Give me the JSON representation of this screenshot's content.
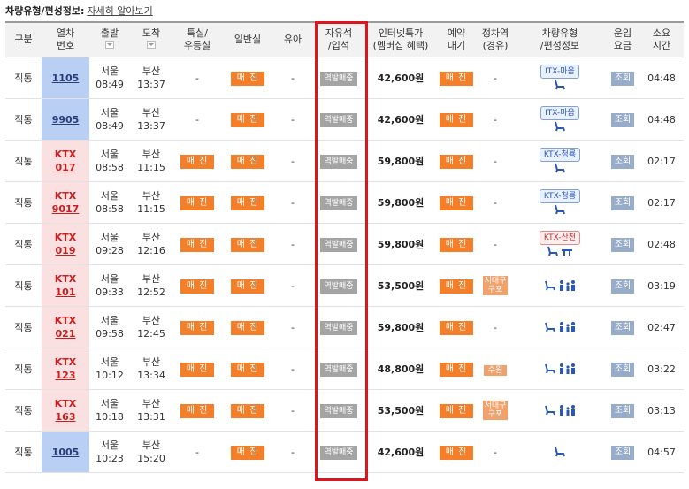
{
  "header": {
    "title": "차량유형/편성정보:",
    "link": "자세히 알아보기"
  },
  "columns": [
    {
      "line1": "구분",
      "line2": ""
    },
    {
      "line1": "열차",
      "line2": "번호"
    },
    {
      "line1": "출발",
      "line2": ""
    },
    {
      "line1": "도착",
      "line2": ""
    },
    {
      "line1": "특실/",
      "line2": "우등실"
    },
    {
      "line1": "일반실",
      "line2": ""
    },
    {
      "line1": "유아",
      "line2": ""
    },
    {
      "line1": "자유석",
      "line2": "/입석"
    },
    {
      "line1": "인터넷특가",
      "line2": "(멤버십 혜택)"
    },
    {
      "line1": "예약",
      "line2": "대기"
    },
    {
      "line1": "정차역",
      "line2": "(경유)"
    },
    {
      "line1": "차량유형",
      "line2": "/편성정보"
    },
    {
      "line1": "운임",
      "line2": "요금"
    },
    {
      "line1": "소요",
      "line2": "시간"
    }
  ],
  "labels": {
    "sold": "매 진",
    "free": "역발매중",
    "lookup": "조회",
    "dash": "-",
    "ktx": "KTX"
  },
  "rows": [
    {
      "type": "직통",
      "prefix": "",
      "num": "1105",
      "cls": "blue",
      "dep": "서울",
      "dep_t": "08:49",
      "arr": "부산",
      "arr_t": "13:37",
      "special": "-",
      "general": "매 진",
      "infant": "-",
      "free": "역발매중",
      "price": "42,600원",
      "wait": "매 진",
      "stop": "-",
      "vehicle": "ITX-마음",
      "icons": [
        "seat"
      ],
      "fare": "조회",
      "dur": "04:48"
    },
    {
      "type": "직통",
      "prefix": "",
      "num": "9905",
      "cls": "blue",
      "dep": "서울",
      "dep_t": "08:49",
      "arr": "부산",
      "arr_t": "13:37",
      "special": "-",
      "general": "매 진",
      "infant": "-",
      "free": "역발매중",
      "price": "42,600원",
      "wait": "매 진",
      "stop": "-",
      "vehicle": "ITX-마음",
      "icons": [
        "seat"
      ],
      "fare": "조회",
      "dur": "04:48"
    },
    {
      "type": "직통",
      "prefix": "KTX",
      "num": "017",
      "cls": "pink",
      "dep": "서울",
      "dep_t": "08:58",
      "arr": "부산",
      "arr_t": "11:15",
      "special": "매 진",
      "general": "매 진",
      "infant": "-",
      "free": "역발매중",
      "price": "59,800원",
      "wait": "매 진",
      "stop": "-",
      "vehicle": "KTX-청룡",
      "icons": [
        "seat"
      ],
      "fare": "조회",
      "dur": "02:17"
    },
    {
      "type": "직통",
      "prefix": "KTX",
      "num": "9017",
      "cls": "pink",
      "dep": "서울",
      "dep_t": "08:58",
      "arr": "부산",
      "arr_t": "11:15",
      "special": "매 진",
      "general": "매 진",
      "infant": "-",
      "free": "역발매중",
      "price": "59,800원",
      "wait": "매 진",
      "stop": "-",
      "vehicle": "KTX-청룡",
      "icons": [
        "seat"
      ],
      "fare": "조회",
      "dur": "02:17"
    },
    {
      "type": "직통",
      "prefix": "KTX",
      "num": "019",
      "cls": "pink",
      "dep": "서울",
      "dep_t": "09:28",
      "arr": "부산",
      "arr_t": "12:16",
      "special": "매 진",
      "general": "매 진",
      "infant": "-",
      "free": "역발매중",
      "price": "59,800원",
      "wait": "매 진",
      "stop": "-",
      "vehicle": "KTX-산천",
      "icons": [
        "seat",
        "table"
      ],
      "fare": "조회",
      "dur": "02:48"
    },
    {
      "type": "직통",
      "prefix": "KTX",
      "num": "101",
      "cls": "pink",
      "dep": "서울",
      "dep_t": "09:33",
      "arr": "부산",
      "arr_t": "12:52",
      "special": "매 진",
      "general": "매 진",
      "infant": "-",
      "free": "역발매중",
      "price": "53,500원",
      "wait": "매 진",
      "stop": "서대구\n구포",
      "vehicle": "",
      "icons": [
        "seat",
        "family"
      ],
      "fare": "조회",
      "dur": "03:19"
    },
    {
      "type": "직통",
      "prefix": "KTX",
      "num": "021",
      "cls": "pink",
      "dep": "서울",
      "dep_t": "09:58",
      "arr": "부산",
      "arr_t": "12:45",
      "special": "매 진",
      "general": "매 진",
      "infant": "-",
      "free": "역발매중",
      "price": "59,800원",
      "wait": "매 진",
      "stop": "-",
      "vehicle": "",
      "icons": [
        "seat",
        "family"
      ],
      "fare": "조회",
      "dur": "02:47"
    },
    {
      "type": "직통",
      "prefix": "KTX",
      "num": "123",
      "cls": "pink",
      "dep": "서울",
      "dep_t": "10:12",
      "arr": "부산",
      "arr_t": "13:34",
      "special": "매 진",
      "general": "매 진",
      "infant": "-",
      "free": "역발매중",
      "price": "48,800원",
      "wait": "매 진",
      "stop": "수원",
      "vehicle": "",
      "icons": [
        "seat",
        "family"
      ],
      "fare": "조회",
      "dur": "03:22"
    },
    {
      "type": "직통",
      "prefix": "KTX",
      "num": "163",
      "cls": "pink",
      "dep": "서울",
      "dep_t": "10:18",
      "arr": "부산",
      "arr_t": "13:31",
      "special": "매 진",
      "general": "매 진",
      "infant": "-",
      "free": "역발매중",
      "price": "53,500원",
      "wait": "매 진",
      "stop": "서대구\n구포",
      "vehicle": "",
      "icons": [
        "seat",
        "family"
      ],
      "fare": "조회",
      "dur": "03:13"
    },
    {
      "type": "직통",
      "prefix": "",
      "num": "1005",
      "cls": "blue",
      "dep": "서울",
      "dep_t": "10:23",
      "arr": "부산",
      "arr_t": "15:20",
      "special": "-",
      "general": "매 진",
      "infant": "-",
      "free": "역발매중",
      "price": "42,600원",
      "wait": "매 진",
      "stop": "-",
      "vehicle": "",
      "icons": [
        "seat"
      ],
      "fare": "조회",
      "dur": "04:57"
    }
  ],
  "colors": {
    "highlight": "#e0151b",
    "sold": "#f47f2a",
    "free": "#a4a4a4"
  }
}
